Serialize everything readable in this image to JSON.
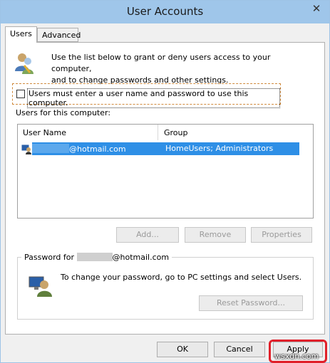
{
  "window": {
    "title": "User Accounts",
    "close_glyph": "✕"
  },
  "tabs": [
    {
      "label": "Users",
      "active": true
    },
    {
      "label": "Advanced",
      "active": false
    }
  ],
  "intro_text": [
    "Use the list below to grant or deny users access to your computer,",
    "and to change passwords and other settings."
  ],
  "require_login": {
    "label": "Users must enter a user name and password to use this computer.",
    "checked": false
  },
  "users_list": {
    "label": "Users for this computer:",
    "columns": [
      "User Name",
      "Group"
    ],
    "rows": [
      {
        "user_name_suffix": "@hotmail.com",
        "group": "HomeUsers; Administrators",
        "selected": true
      }
    ]
  },
  "list_buttons": {
    "add": "Add...",
    "remove": "Remove",
    "properties": "Properties"
  },
  "password_group": {
    "legend_prefix": "Password for ",
    "legend_suffix": "@hotmail.com",
    "text": "To change your password, go to PC settings and select Users.",
    "reset_button": "Reset Password..."
  },
  "dialog_buttons": {
    "ok": "OK",
    "cancel": "Cancel",
    "apply": "Apply"
  },
  "watermark": "wsxdn.com",
  "colors": {
    "titlebar": "#9fc6ea",
    "selection": "#2e8fe6",
    "highlight_box": "#e0202a",
    "focus_border": "#d08a3c"
  }
}
